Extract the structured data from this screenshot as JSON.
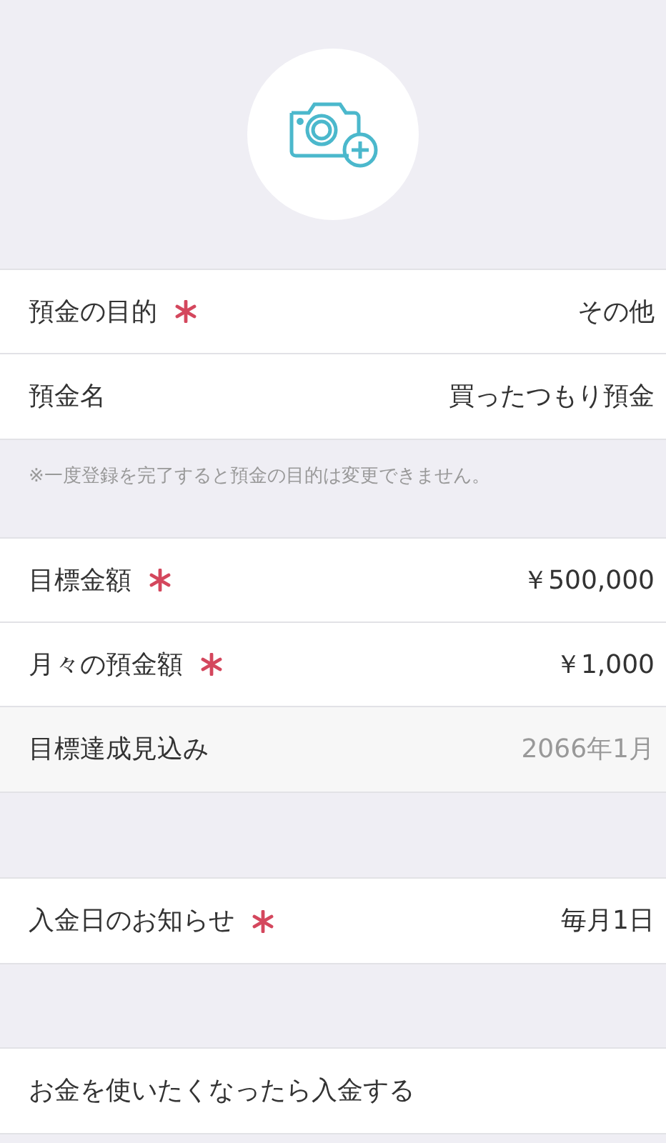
{
  "groups": [
    {
      "rows": [
        {
          "kind": "input",
          "label": "預金の目的",
          "required": true,
          "value": "その他"
        },
        {
          "kind": "input",
          "label": "預金名",
          "required": false,
          "value": "買ったつもり預金"
        }
      ],
      "note": "※一度登録を完了すると預金の目的は変更できません。"
    },
    {
      "rows": [
        {
          "kind": "input",
          "label": "目標金額",
          "required": true,
          "value": "￥500,000"
        },
        {
          "kind": "input",
          "label": "月々の預金額",
          "required": true,
          "value": "￥1,000"
        },
        {
          "kind": "readonly",
          "label": "目標達成見込み",
          "required": false,
          "value": "2066年1月"
        }
      ]
    },
    {
      "rows": [
        {
          "kind": "input",
          "label": "入金日のお知らせ",
          "required": true,
          "value": "毎月1日"
        }
      ]
    },
    {
      "rows": [
        {
          "kind": "input",
          "label": "お金を使いたくなったら入金する",
          "required": false
        }
      ]
    }
  ]
}
